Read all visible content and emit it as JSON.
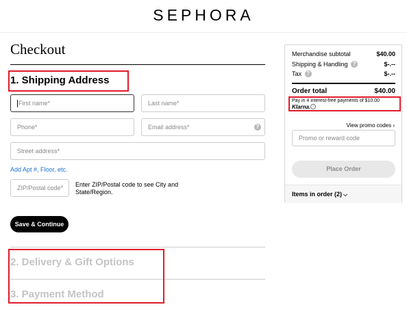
{
  "brand": "SEPHORA",
  "page_title": "Checkout",
  "sections": [
    {
      "label": "1. Shipping Address"
    },
    {
      "label": "2. Delivery & Gift Options"
    },
    {
      "label": "3. Payment Method"
    }
  ],
  "form": {
    "first_name_placeholder": "First name*",
    "last_name_placeholder": "Last name*",
    "phone_placeholder": "Phone*",
    "email_placeholder": "Email address*",
    "street_placeholder": "Street address*",
    "add_apt_link": "Add Apt #, Floor, etc.",
    "zip_placeholder": "ZIP/Postal code*",
    "zip_hint": "Enter ZIP/Postal code to see City and State/Region.",
    "save_button": "Save & Continue"
  },
  "summary": {
    "merch_label": "Merchandise subtotal",
    "merch_value": "$40.00",
    "shipping_label": "Shipping & Handling",
    "shipping_value": "$-.--",
    "tax_label": "Tax",
    "tax_value": "$-.--",
    "total_label": "Order total",
    "total_value": "$40.00",
    "klarna_text": "Pay in 4 interest-free payments of $10.00",
    "klarna_logo": "Klarna.",
    "promo_link": "View promo codes ›",
    "promo_placeholder": "Promo or reward code",
    "place_order": "Place Order",
    "items_label": "Items in order (2)"
  },
  "colors": {
    "annotation_red": "#e11b2b",
    "link_blue": "#1b6fd6",
    "disabled_text": "#c4c4c4"
  },
  "icons": {
    "help": "question-circle-icon",
    "info": "info-circle-icon",
    "chevron": "chevron-down-icon"
  }
}
